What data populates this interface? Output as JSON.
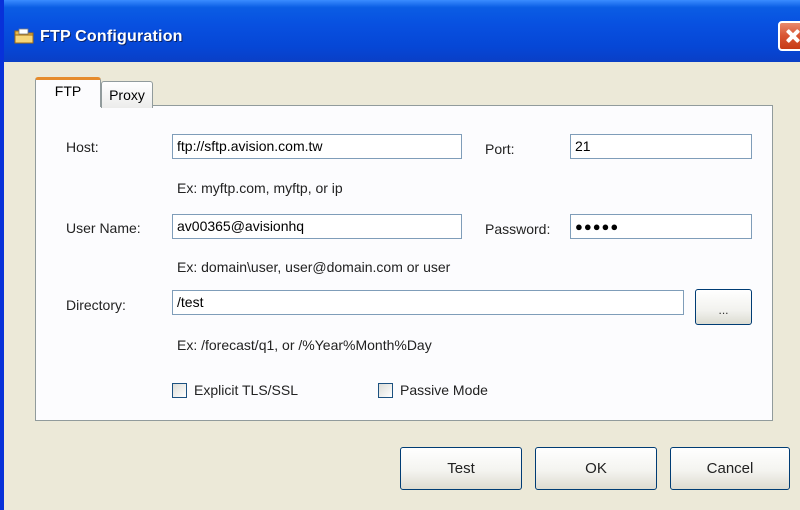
{
  "window": {
    "title": "FTP Configuration",
    "title_icon": "folder-icon",
    "close_icon": "close-icon"
  },
  "tabs": [
    {
      "label": "FTP",
      "active": true
    },
    {
      "label": "Proxy",
      "active": false
    }
  ],
  "form": {
    "host": {
      "label": "Host:",
      "value": "ftp://sftp.avision.com.tw",
      "hint": "Ex: myftp.com, myftp, or ip"
    },
    "port": {
      "label": "Port:",
      "value": "21"
    },
    "username": {
      "label": "User Name:",
      "value": "av00365@avisionhq",
      "hint": "Ex: domain\\user, user@domain.com or user"
    },
    "password": {
      "label": "Password:",
      "value": "●●●●●"
    },
    "directory": {
      "label": "Directory:",
      "value": "/test",
      "hint": "Ex: /forecast/q1, or /%Year%Month%Day"
    },
    "browse_label": "...",
    "explicit_tls": {
      "label": "Explicit TLS/SSL",
      "checked": false
    },
    "passive_mode": {
      "label": "Passive Mode",
      "checked": false
    }
  },
  "buttons": {
    "test": "Test",
    "ok": "OK",
    "cancel": "Cancel"
  },
  "colors": {
    "titlebar": "#0a5de4",
    "tab_accent": "#e68b2c",
    "close": "#d85432"
  }
}
